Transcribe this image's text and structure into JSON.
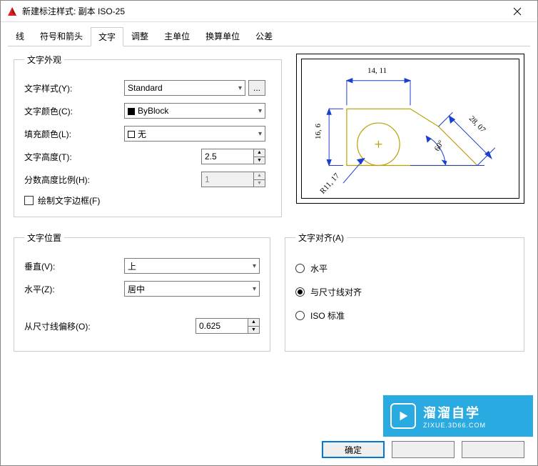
{
  "window": {
    "title": "新建标注样式: 副本 ISO-25"
  },
  "tabs": {
    "items": [
      "线",
      "符号和箭头",
      "文字",
      "调整",
      "主单位",
      "换算单位",
      "公差"
    ],
    "active": 2
  },
  "appearance": {
    "legend": "文字外观",
    "style_label": "文字样式(Y):",
    "style_value": "Standard",
    "color_label": "文字颜色(C):",
    "color_value": "ByBlock",
    "fill_label": "填充颜色(L):",
    "fill_value": "无",
    "height_label": "文字高度(T):",
    "height_value": "2.5",
    "fraction_label": "分数高度比例(H):",
    "fraction_value": "1",
    "frame_label": "绘制文字边框(F)"
  },
  "position": {
    "legend": "文字位置",
    "vertical_label": "垂直(V):",
    "vertical_value": "上",
    "horizontal_label": "水平(Z):",
    "horizontal_value": "居中",
    "offset_label": "从尺寸线偏移(O):",
    "offset_value": "0.625"
  },
  "alignment": {
    "legend": "文字对齐(A)",
    "horizontal": "水平",
    "dimline": "与尺寸线对齐",
    "iso": "ISO 标准",
    "selected": "dimline"
  },
  "preview": {
    "dim_top": "14, 11",
    "dim_left": "16, 6",
    "dim_radius": "R11, 17",
    "dim_angle": "60°",
    "dim_diag": "28, 07"
  },
  "buttons": {
    "ok": "确定"
  },
  "watermark": {
    "brand": "溜溜自学",
    "url": "ZIXUE.3D66.COM"
  }
}
